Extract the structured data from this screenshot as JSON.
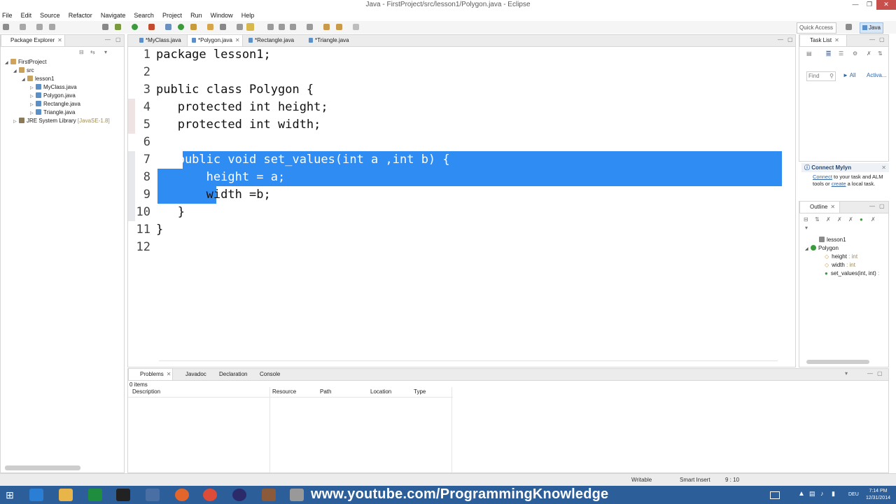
{
  "window": {
    "title": "Java - FirstProject/src/lesson1/Polygon.java - Eclipse"
  },
  "menu": [
    "File",
    "Edit",
    "Source",
    "Refactor",
    "Navigate",
    "Search",
    "Project",
    "Run",
    "Window",
    "Help"
  ],
  "toolbar": {
    "quick_access": "Quick Access",
    "perspective": "Java"
  },
  "package_explorer": {
    "tab": "Package Explorer",
    "items": [
      "FirstProject",
      "src",
      "lesson1",
      "MyClass.java",
      "Polygon.java",
      "Rectangle.java",
      "Triangle.java"
    ],
    "jre_label": "JRE System Library",
    "jre_version": "[JavaSE-1.8]"
  },
  "editor": {
    "tabs": [
      "*MyClass.java",
      "*Polygon.java",
      "*Rectangle.java",
      "*Triangle.java"
    ],
    "lines": [
      {
        "n": "1",
        "text": "package lesson1;"
      },
      {
        "n": "2",
        "text": ""
      },
      {
        "n": "3",
        "text": "public class Polygon {"
      },
      {
        "n": "4",
        "text": "   protected int height;"
      },
      {
        "n": "5",
        "text": "   protected int width;"
      },
      {
        "n": "6",
        "text": ""
      },
      {
        "n": "7",
        "text": "   public void set_values(int a ,int b) {"
      },
      {
        "n": "8",
        "text": "       height = a;"
      },
      {
        "n": "9",
        "text": "       width =b;"
      },
      {
        "n": "10",
        "text": "   }"
      },
      {
        "n": "11",
        "text": "}"
      },
      {
        "n": "12",
        "text": ""
      }
    ]
  },
  "task_list": {
    "tab": "Task List",
    "find_placeholder": "Find",
    "all": "All",
    "activate": "Activa..."
  },
  "mylyn": {
    "title": "Connect Mylyn",
    "link_connect": "Connect",
    "text1": " to your task and ALM tools or ",
    "link_create": "create",
    "text2": " a local task."
  },
  "outline": {
    "tab": "Outline",
    "package": "lesson1",
    "class": "Polygon",
    "members": [
      {
        "name": "height",
        "type": " : int"
      },
      {
        "name": "width",
        "type": " : int"
      },
      {
        "name": "set_values(int, int)",
        "type": " :"
      }
    ]
  },
  "bottom": {
    "tabs": [
      "Problems",
      "Javadoc",
      "Declaration",
      "Console"
    ],
    "count": "0 items",
    "columns": [
      "Description",
      "Resource",
      "Path",
      "Location",
      "Type"
    ]
  },
  "status": {
    "writable": "Writable",
    "insert": "Smart Insert",
    "position": "9 : 10"
  },
  "taskbar": {
    "watermark": "www.youtube.com/ProgrammingKnowledge",
    "time": "7:14 PM",
    "date": "12/31/2014",
    "lang": "DEU"
  }
}
